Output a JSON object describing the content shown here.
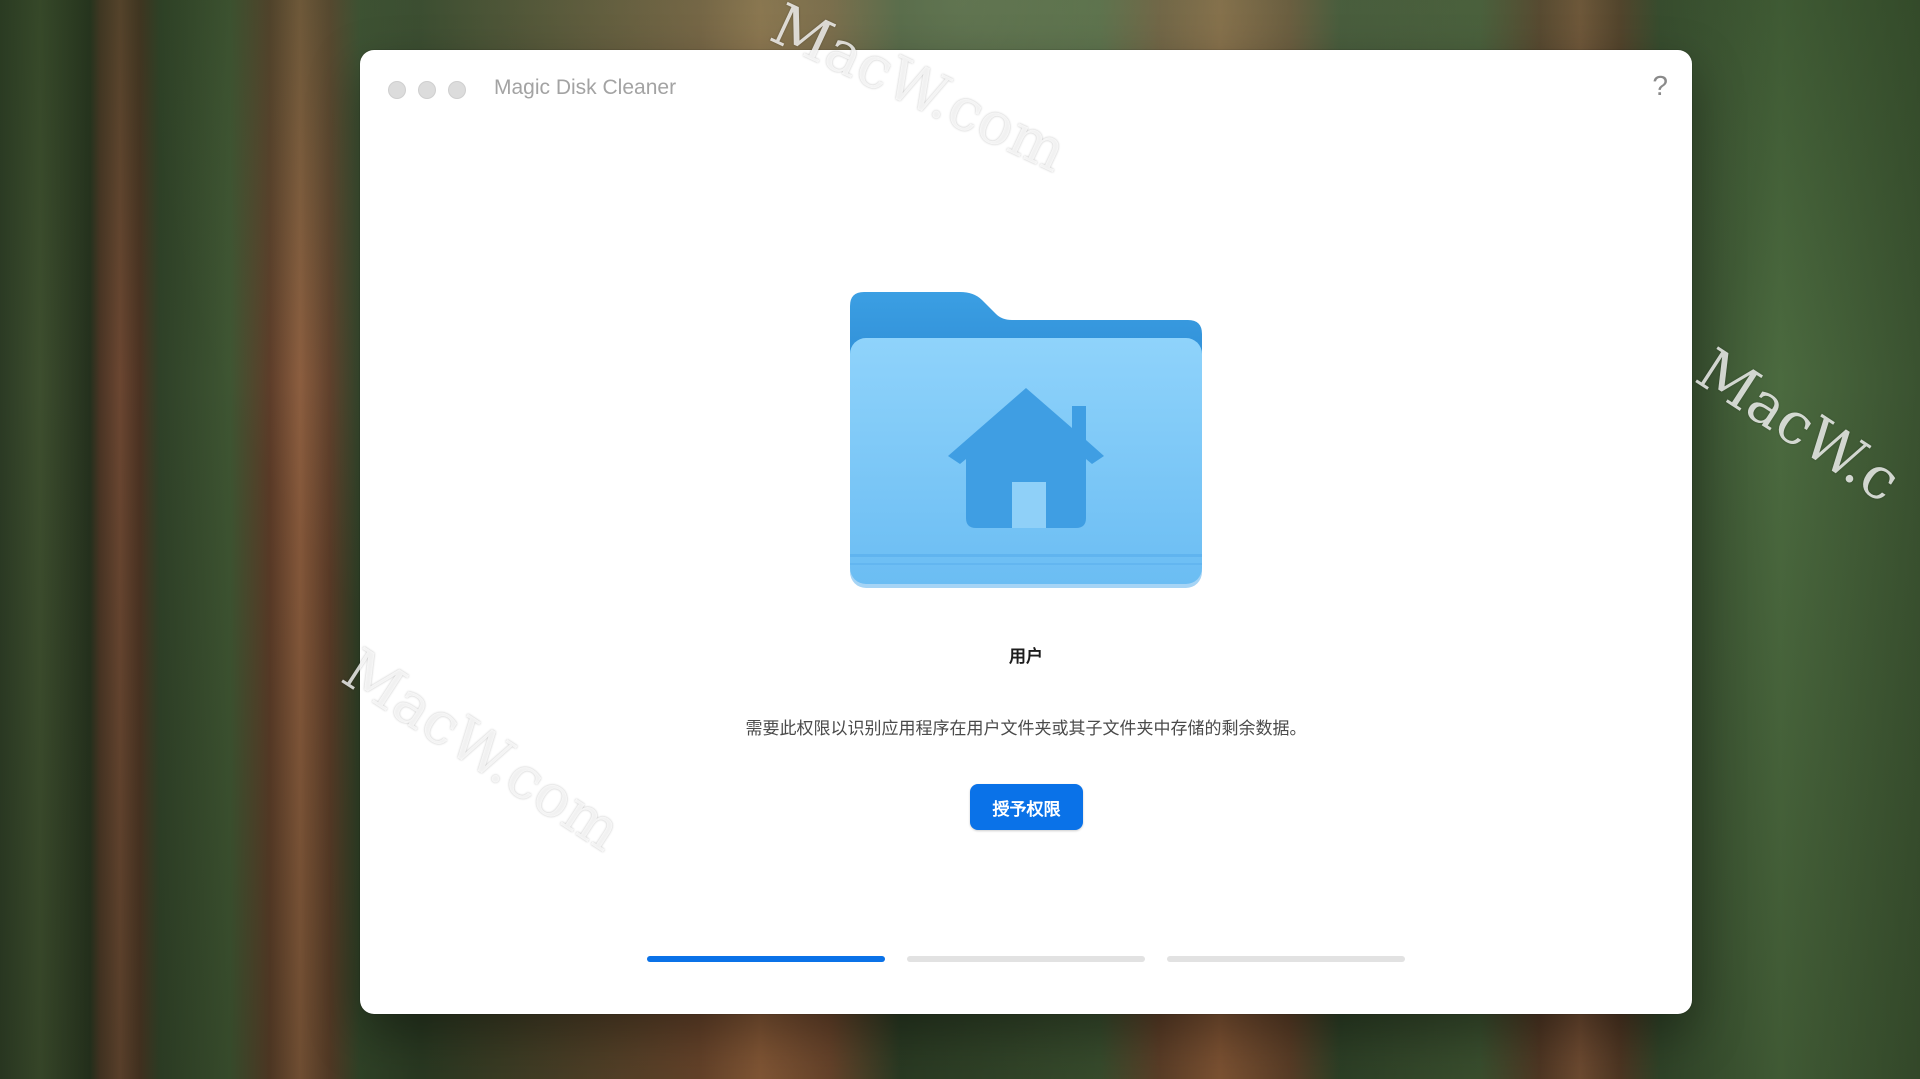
{
  "window": {
    "title": "Magic Disk Cleaner",
    "help_label": "?"
  },
  "permission": {
    "folder_icon": "user-home-folder-icon",
    "folder_name": "用户",
    "description": "需要此权限以识别应用程序在用户文件夹或其子文件夹中存储的剩余数据。",
    "button_label": "授予权限"
  },
  "steps": [
    {
      "progress": 1.0
    },
    {
      "progress": 0.0
    },
    {
      "progress": 0.0
    }
  ],
  "watermarks": [
    "MacW.com",
    "MacW.c",
    "MacW.com"
  ],
  "colors": {
    "accent": "#0a72e8",
    "folder_light": "#7ecbf8",
    "folder_dark": "#3a9fe6"
  }
}
